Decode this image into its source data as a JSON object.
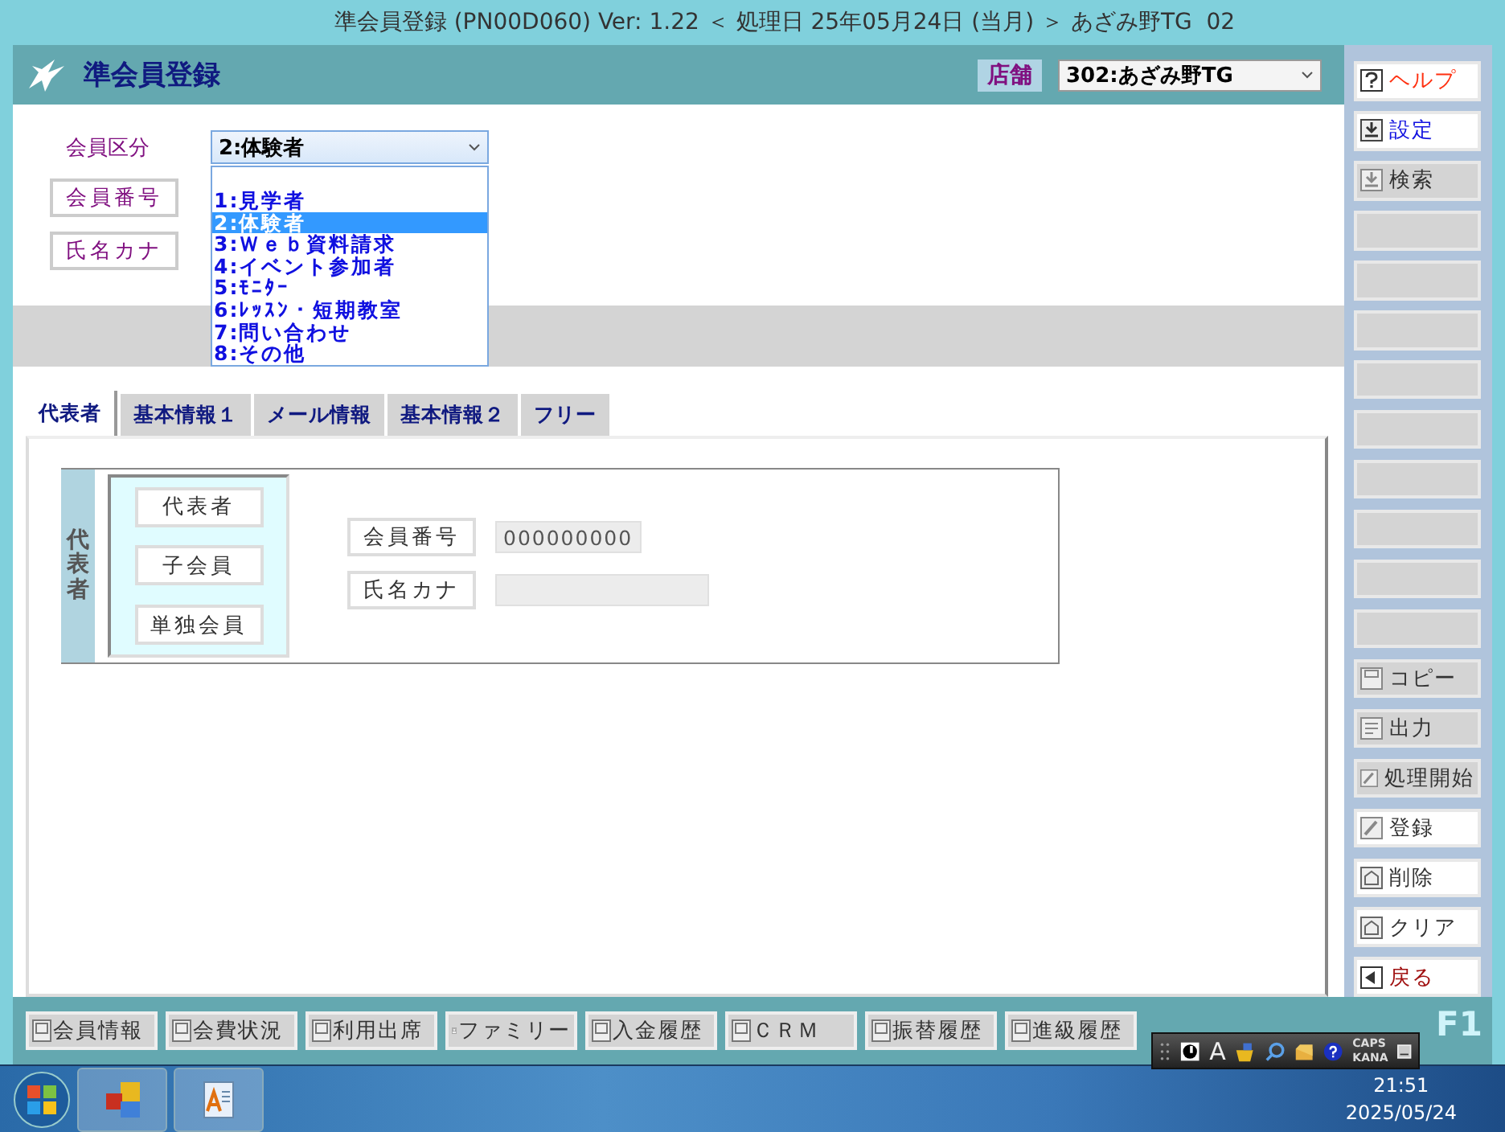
{
  "window": {
    "title": "準会員登録 (PN00D060) Ver: 1.22 ＜ 処理日 25年05月24日 (当月) ＞ あざみ野TG  02"
  },
  "header": {
    "title": "準会員登録",
    "store_label": "店舗",
    "store_value": "302:あざみ野TG"
  },
  "member_type": {
    "label": "会員区分",
    "value": "2:体験者",
    "expanded": true,
    "options": [
      {
        "label": "1:見学者",
        "selected": false
      },
      {
        "label": "2:体験者",
        "selected": true
      },
      {
        "label": "3:Ｗｅｂ資料請求",
        "selected": false
      },
      {
        "label": "4:イベント参加者",
        "selected": false
      },
      {
        "label": "5:ﾓﾆﾀｰ",
        "selected": false
      },
      {
        "label": "6:ﾚｯｽﾝ・短期教室",
        "selected": false
      },
      {
        "label": "7:問い合わせ",
        "selected": false
      },
      {
        "label": "8:その他",
        "selected": false
      }
    ]
  },
  "search_buttons": [
    "会員番号",
    "氏名カナ"
  ],
  "tabs": [
    {
      "label": "代表者",
      "selected": true
    },
    {
      "label": "基本情報１",
      "selected": false
    },
    {
      "label": "メール情報",
      "selected": false
    },
    {
      "label": "基本情報２",
      "selected": false
    },
    {
      "label": "フリー",
      "selected": false
    }
  ],
  "representative_panel": {
    "caption": "代表者",
    "type_buttons": [
      "代表者",
      "子会員",
      "単独会員"
    ],
    "fields": [
      {
        "label": "会員番号",
        "value": "000000000"
      },
      {
        "label": "氏名カナ"
      }
    ]
  },
  "side_buttons": [
    {
      "kind": "help",
      "label": "ヘルプ",
      "disabled": false
    },
    {
      "kind": "setting",
      "label": "設定",
      "disabled": false
    },
    {
      "kind": "search",
      "label": "検索",
      "disabled": true
    },
    {
      "kind": "blank",
      "disabled": true
    },
    {
      "kind": "blank",
      "disabled": true
    },
    {
      "kind": "blank",
      "disabled": true
    },
    {
      "kind": "blank",
      "disabled": true
    },
    {
      "kind": "blank",
      "disabled": true
    },
    {
      "kind": "blank",
      "disabled": true
    },
    {
      "kind": "blank",
      "disabled": true
    },
    {
      "kind": "blank",
      "disabled": true
    },
    {
      "kind": "blank",
      "disabled": true
    },
    {
      "kind": "copy",
      "label": "コピー",
      "disabled": true
    },
    {
      "kind": "output",
      "label": "出力",
      "disabled": true
    },
    {
      "kind": "process",
      "label": "処理開始",
      "disabled": true
    },
    {
      "kind": "register",
      "label": "登録",
      "disabled": false
    },
    {
      "kind": "delete",
      "label": "削除",
      "disabled": false
    },
    {
      "kind": "clear",
      "label": "クリア",
      "disabled": false
    },
    {
      "kind": "back",
      "label": "戻る",
      "disabled": false
    }
  ],
  "bottom_buttons": [
    "会員情報",
    "会費状況",
    "利用出席",
    "ファミリー",
    "入金履歴",
    "ＣＲＭ",
    "振替履歴",
    "進級履歴"
  ],
  "brand": "F1",
  "ime_bar": {
    "letter": "A",
    "caps": "CAPS",
    "kana": "KANA"
  },
  "taskbar": {
    "time": "21:51",
    "date": "2025/05/24"
  }
}
